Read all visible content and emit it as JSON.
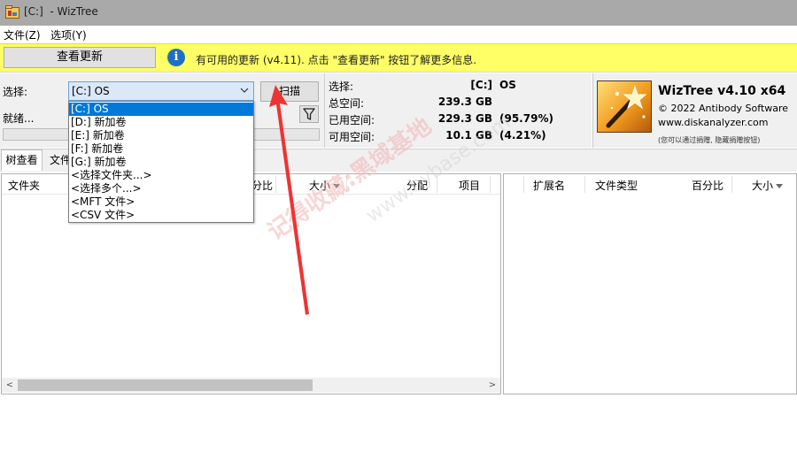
{
  "window": {
    "title": "[C:]  - WizTree"
  },
  "menu": {
    "items": [
      {
        "label": "文件(Z)"
      },
      {
        "label": "选项(Y)"
      }
    ]
  },
  "update_bar": {
    "button_label": "查看更新",
    "info_glyph": "i",
    "message": "有可用的更新 (v4.11). 点击 \"查看更新\" 按钮了解更多信息.",
    "background_color": "#ffff66"
  },
  "controls": {
    "select_label": "选择:",
    "status_label": "就绪...",
    "selected_drive": "[C:] OS",
    "scan_label": "扫描",
    "filter_icon": "filter-icon",
    "progress": 0
  },
  "dropdown": {
    "options": [
      {
        "label": "[C:] OS",
        "selected": true
      },
      {
        "label": "[D:] 新加卷",
        "selected": false
      },
      {
        "label": "[E:] 新加卷",
        "selected": false
      },
      {
        "label": "[F:] 新加卷",
        "selected": false
      },
      {
        "label": "[G:] 新加卷",
        "selected": false
      },
      {
        "label": "<选择文件夹...>",
        "selected": false
      },
      {
        "label": "<选择多个...>",
        "selected": false
      },
      {
        "label": "<MFT 文件>",
        "selected": false
      },
      {
        "label": "<CSV 文件>",
        "selected": false
      }
    ]
  },
  "stats": {
    "select_label": "选择:",
    "select_drive": "[C:]",
    "select_name": "OS",
    "total_label": "总空间:",
    "total_value": "239.3 GB",
    "used_label": "已用空间:",
    "used_value": "229.3 GB",
    "used_pct": "(95.79%)",
    "free_label": "可用空间:",
    "free_value": "10.1 GB",
    "free_pct": "(4.21%)"
  },
  "about": {
    "title": "WizTree v4.10 x64",
    "copyright": "© 2022 Antibody Software",
    "website": "www.diskanalyzer.com",
    "note": "(您可以通过捐赠, 隐藏捐赠按钮)"
  },
  "tabs": [
    {
      "label": "树查看",
      "active": true
    },
    {
      "label": "文件",
      "active": false
    }
  ],
  "left_table": {
    "columns": [
      {
        "label": "文件夹"
      },
      {
        "label": "分比"
      },
      {
        "label": "大小"
      },
      {
        "label": "分配"
      },
      {
        "label": "项目"
      }
    ],
    "scroll_left": "<",
    "scroll_right": ">"
  },
  "right_table": {
    "columns": [
      {
        "label": "扩展名"
      },
      {
        "label": "文件类型"
      },
      {
        "label": "百分比"
      },
      {
        "label": "大小"
      }
    ]
  },
  "watermark": {
    "line1": "记得收藏:黑域基地",
    "line2": "www.hybase.com"
  },
  "colors": {
    "accent": "#0078d7",
    "annotation_arrow": "#ee3333",
    "select_bg": "#dbe8f8"
  }
}
